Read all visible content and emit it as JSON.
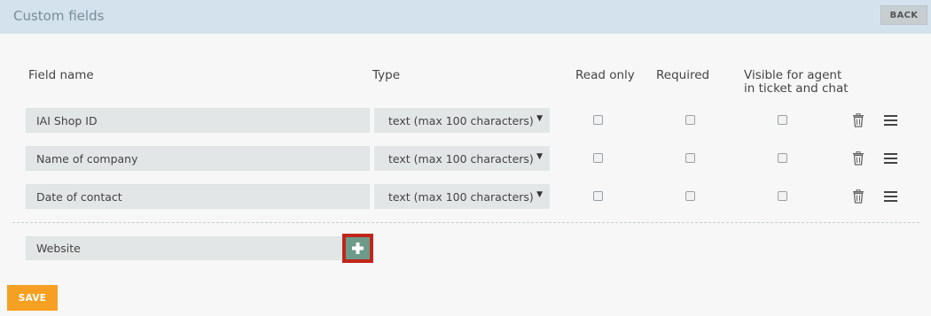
{
  "header": {
    "title": "Custom fields",
    "back_label": "BACK"
  },
  "columns": {
    "field_name": "Field name",
    "type": "Type",
    "read_only": "Read only",
    "required": "Required",
    "visible_line1": "Visible for agent",
    "visible_line2": "in ticket and chat"
  },
  "rows": [
    {
      "name": "IAI Shop ID",
      "type": "text (max 100 characters)",
      "read_only": false,
      "required": false,
      "visible": false
    },
    {
      "name": "Name of company",
      "type": "text (max 100 characters)",
      "read_only": false,
      "required": false,
      "visible": false
    },
    {
      "name": "Date of contact",
      "type": "text (max 100 characters)",
      "read_only": false,
      "required": false,
      "visible": false
    }
  ],
  "new_field": {
    "value": "Website"
  },
  "save_label": "SAVE",
  "icons": {
    "delete": "trash-icon",
    "reorder": "hamburger-menu-icon",
    "add": "plus-icon",
    "select": "dropdown-arrow-icon"
  },
  "colors": {
    "header_bg": "#d3e2ec",
    "save_button": "#f5a022",
    "add_button": "#6e9a8a",
    "add_highlight": "#c0251a"
  }
}
